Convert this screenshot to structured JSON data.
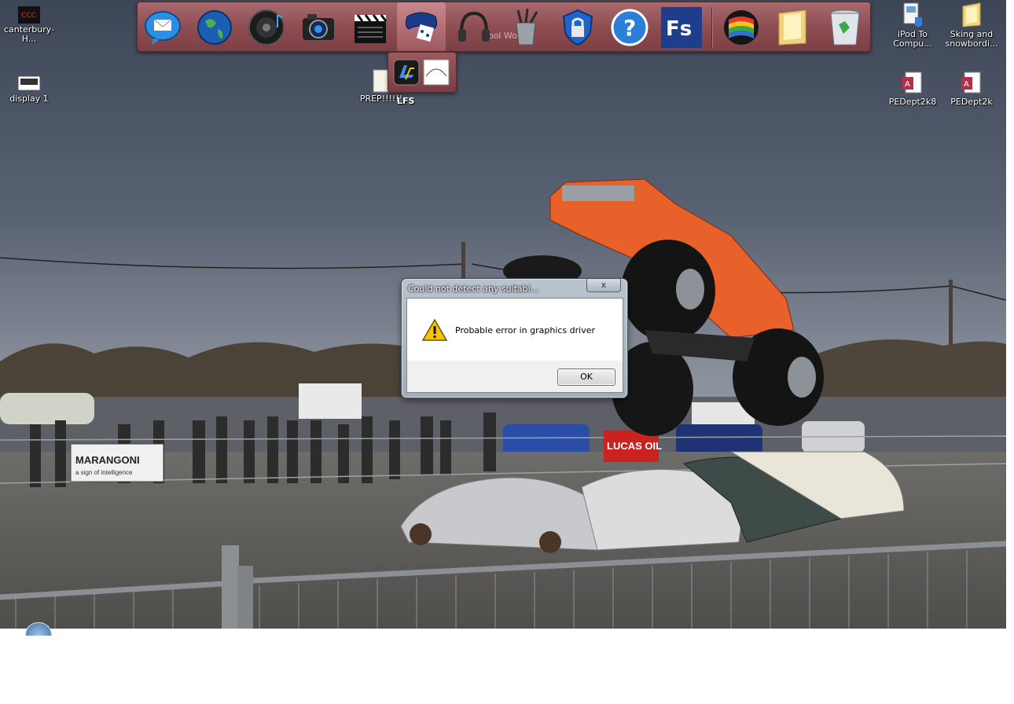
{
  "desktop_icons": [
    {
      "label": "canterbury-H...",
      "icon": "canterbury-logo-icon"
    },
    {
      "label": "display 1",
      "icon": "display-shortcut-icon"
    },
    {
      "label": "iPod To Compu...",
      "icon": "ipod-to-computer-icon"
    },
    {
      "label": "Sking and snowbordi...",
      "icon": "folder-icon"
    },
    {
      "label": "PEDept2k8",
      "icon": "access-database-icon"
    },
    {
      "label": "PEDept2k",
      "icon": "access-database-icon"
    },
    {
      "label": "PREP!!!!!!",
      "icon": "document-icon"
    }
  ],
  "dock": {
    "items": [
      {
        "icon": "mail-icon"
      },
      {
        "icon": "globe-icon"
      },
      {
        "icon": "speaker-icon"
      },
      {
        "icon": "camera-icon"
      },
      {
        "icon": "clapperboard-icon"
      },
      {
        "icon": "gamepad-icon"
      },
      {
        "icon": "headphones-icon"
      },
      {
        "icon": "pencil-cup-icon"
      },
      {
        "icon": "security-shield-icon"
      },
      {
        "icon": "help-icon"
      },
      {
        "icon": "fs-app-icon"
      },
      {
        "icon": "windows-flag-icon"
      },
      {
        "icon": "folder-icon"
      },
      {
        "icon": "recycle-bin-icon"
      }
    ],
    "background_ghost_text": "hool Wo",
    "stack": {
      "label": "LFS",
      "items": [
        {
          "icon": "lfs-app-icon"
        },
        {
          "icon": "blank-app-icon"
        }
      ]
    }
  },
  "dialog": {
    "title": "Could not detect any suitabl...",
    "close_label": "x",
    "message": "Probable error in graphics driver",
    "ok_label": "OK",
    "icon": "warning-icon"
  },
  "wallpaper": {
    "banners": [
      {
        "text": "MARANGONI"
      },
      {
        "text": "a sign of intelligence"
      },
      {
        "text": "LUCAS OIL"
      }
    ]
  },
  "colors": {
    "dock_bg": "#8e4e53",
    "dialog_frame": "#b9c4ce",
    "warning_yellow": "#f5c400",
    "truck_orange": "#e8602a"
  }
}
